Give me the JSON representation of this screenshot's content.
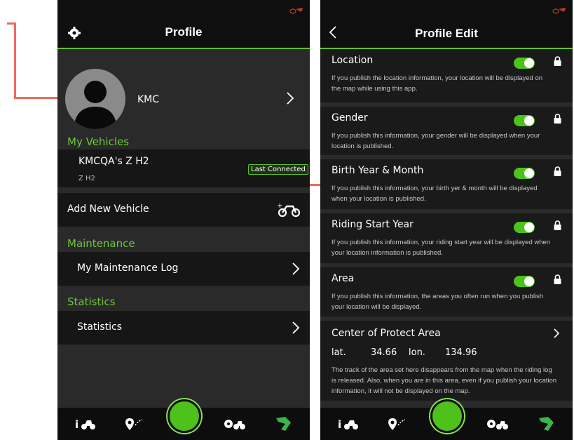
{
  "left_screen": {
    "header_title": "Profile",
    "user_name": "KMC",
    "my_vehicles_label": "My Vehicles",
    "vehicle": {
      "name": "KMCQA's Z H2",
      "model": "Z H2",
      "badge": "Last Connected"
    },
    "add_vehicle_label": "Add New Vehicle",
    "maintenance_label": "Maintenance",
    "maintenance_item": "My Maintenance Log",
    "statistics_label": "Statistics",
    "statistics_item": "Statistics"
  },
  "right_screen": {
    "header_title": "Profile Edit",
    "settings": [
      {
        "title": "Location",
        "desc": "If you publish the location information, your location will be displayed on the map while using this app.",
        "enabled": true
      },
      {
        "title": "Gender",
        "desc": "If you publish this information, your gender will be displayed when your location is published.",
        "enabled": true
      },
      {
        "title": "Birth Year & Month",
        "desc": "If you publish this information, your birth yer & month will be displayed when your location is published.",
        "enabled": true
      },
      {
        "title": "Riding Start Year",
        "desc": "If you publish this information, your riding start year will be displayed when your location information is published.",
        "enabled": true
      },
      {
        "title": "Area",
        "desc": "If you publish this information, the areas you often run when you publish your location will be displayed.",
        "enabled": true
      }
    ],
    "protect_area": {
      "title": "Center of Protect Area",
      "lat_label": "lat.",
      "lat_value": "34.66",
      "lon_label": "lon.",
      "lon_value": "134.96",
      "desc": "The track of the area set here disappears from the map when the riding log is released. Also, when you are in this area, even if you publish your location information, it will not be displayed on the map."
    }
  },
  "colors": {
    "accent": "#5fbf2e",
    "annotation": "#ef6a5a",
    "background": "#2a2a2a"
  },
  "icons": [
    "gear-icon",
    "chevron-right-icon",
    "chevron-left-icon",
    "lock-icon",
    "add-motorcycle-icon",
    "info-motorcycle-icon",
    "map-pin-icon",
    "record-button",
    "settings-motorcycle-icon",
    "brand-logo-icon"
  ]
}
